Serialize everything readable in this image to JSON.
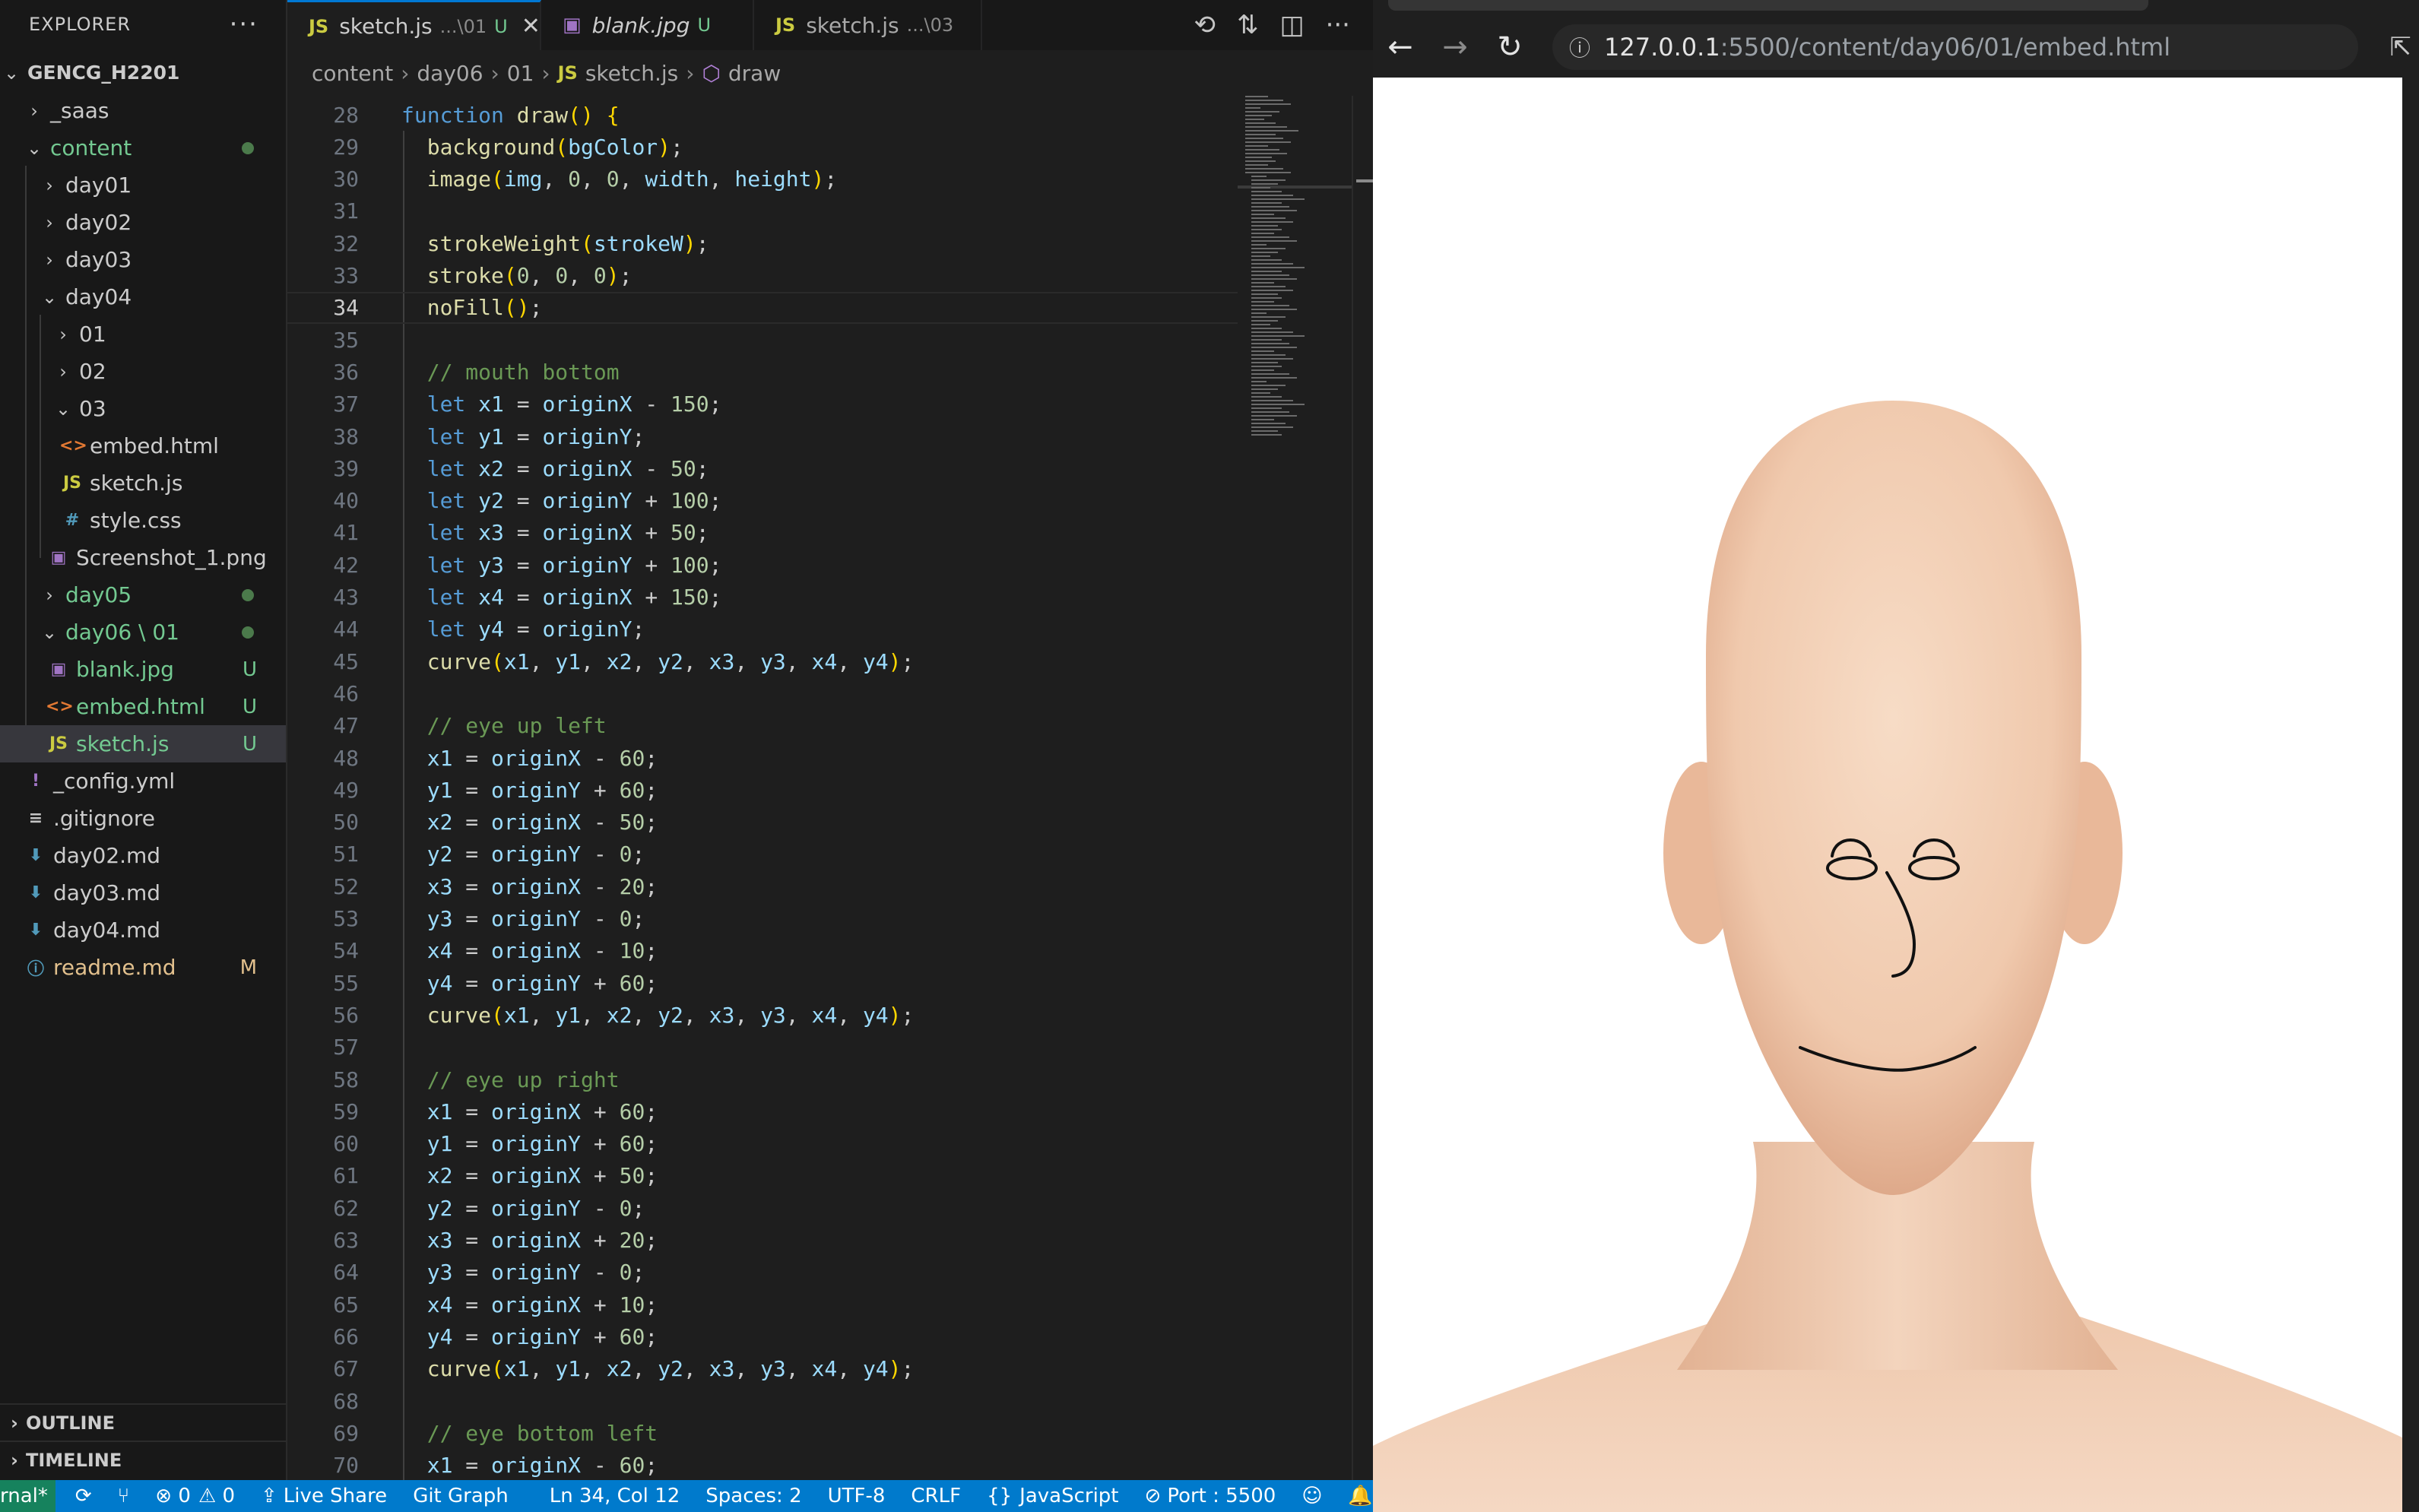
{
  "explorer": {
    "title": "EXPLORER",
    "more": "···",
    "root": "GENCG_H2201",
    "items": [
      {
        "label": "_saas",
        "badge": ""
      },
      {
        "label": "content",
        "badge": ""
      },
      {
        "label": "day01",
        "badge": ""
      },
      {
        "label": "day02",
        "badge": ""
      },
      {
        "label": "day03",
        "badge": ""
      },
      {
        "label": "day04",
        "badge": ""
      },
      {
        "label": "01",
        "badge": ""
      },
      {
        "label": "02",
        "badge": ""
      },
      {
        "label": "03",
        "badge": ""
      },
      {
        "label": "embed.html",
        "badge": ""
      },
      {
        "label": "sketch.js",
        "badge": ""
      },
      {
        "label": "style.css",
        "badge": ""
      },
      {
        "label": "Screenshot_1.png",
        "badge": ""
      },
      {
        "label": "day05",
        "badge": ""
      },
      {
        "label": "day06 \\ 01",
        "badge": ""
      },
      {
        "label": "blank.jpg",
        "badge": "U"
      },
      {
        "label": "embed.html",
        "badge": "U"
      },
      {
        "label": "sketch.js",
        "badge": "U"
      },
      {
        "label": "_config.yml",
        "badge": ""
      },
      {
        "label": ".gitignore",
        "badge": ""
      },
      {
        "label": "day02.md",
        "badge": ""
      },
      {
        "label": "day03.md",
        "badge": ""
      },
      {
        "label": "day04.md",
        "badge": ""
      },
      {
        "label": "readme.md",
        "badge": "M"
      }
    ],
    "outline": "OUTLINE",
    "timeline": "TIMELINE"
  },
  "tabs": [
    {
      "icon": "JS",
      "label": "sketch.js",
      "desc": "...\\01",
      "status": "U",
      "close": "✕"
    },
    {
      "icon": "▣",
      "label": "blank.jpg",
      "desc": "",
      "status": "U",
      "close": ""
    },
    {
      "icon": "JS",
      "label": "sketch.js",
      "desc": "...\\03",
      "status": "",
      "close": ""
    }
  ],
  "breadcrumb": [
    "content",
    "day06",
    "01",
    "sketch.js",
    "draw"
  ],
  "code": {
    "current_line": 34,
    "lines": [
      {
        "n": "28"
      },
      {
        "n": "29"
      },
      {
        "n": "30"
      },
      {
        "n": "31"
      },
      {
        "n": "32"
      },
      {
        "n": "33"
      },
      {
        "n": "34"
      },
      {
        "n": "35"
      },
      {
        "n": "36"
      },
      {
        "n": "37"
      },
      {
        "n": "38"
      },
      {
        "n": "39"
      },
      {
        "n": "40"
      },
      {
        "n": "41"
      },
      {
        "n": "42"
      },
      {
        "n": "43"
      },
      {
        "n": "44"
      },
      {
        "n": "45"
      },
      {
        "n": "46"
      },
      {
        "n": "47"
      },
      {
        "n": "48"
      },
      {
        "n": "49"
      },
      {
        "n": "50"
      },
      {
        "n": "51"
      },
      {
        "n": "52"
      },
      {
        "n": "53"
      },
      {
        "n": "54"
      },
      {
        "n": "55"
      },
      {
        "n": "56"
      },
      {
        "n": "57"
      },
      {
        "n": "58"
      },
      {
        "n": "59"
      },
      {
        "n": "60"
      },
      {
        "n": "61"
      },
      {
        "n": "62"
      },
      {
        "n": "63"
      },
      {
        "n": "64"
      },
      {
        "n": "65"
      },
      {
        "n": "66"
      },
      {
        "n": "67"
      },
      {
        "n": "68"
      },
      {
        "n": "69"
      },
      {
        "n": "70"
      }
    ],
    "text": [
      "function draw() {",
      "  background(bgColor);",
      "  image(img, 0, 0, width, height);",
      "",
      "  strokeWeight(strokeW);",
      "  stroke(0, 0, 0);",
      "  noFill();",
      "",
      "  // mouth bottom",
      "  let x1 = originX - 150;",
      "  let y1 = originY;",
      "  let x2 = originX - 50;",
      "  let y2 = originY + 100;",
      "  let x3 = originX + 50;",
      "  let y3 = originY + 100;",
      "  let x4 = originX + 150;",
      "  let y4 = originY;",
      "  curve(x1, y1, x2, y2, x3, y3, x4, y4);",
      "",
      "  // eye up left",
      "  x1 = originX - 60;",
      "  y1 = originY + 60;",
      "  x2 = originX - 50;",
      "  y2 = originY - 0;",
      "  x3 = originX - 20;",
      "  y3 = originY - 0;",
      "  x4 = originX - 10;",
      "  y4 = originY + 60;",
      "  curve(x1, y1, x2, y2, x3, y3, x4, y4);",
      "",
      "  // eye up right",
      "  x1 = originX + 60;",
      "  y1 = originY + 60;",
      "  x2 = originX + 50;",
      "  y2 = originY - 0;",
      "  x3 = originX + 20;",
      "  y3 = originY - 0;",
      "  x4 = originX + 10;",
      "  y4 = originY + 60;",
      "  curve(x1, y1, x2, y2, x3, y3, x4, y4);",
      "",
      "  // eye bottom left",
      "  x1 = originX - 60;"
    ]
  },
  "statusbar": {
    "remote": "rnal*",
    "sync": "⟳",
    "errors": "⊗ 0",
    "warnings": "⚠ 0",
    "live_share": "Live Share",
    "git_graph": "Git Graph",
    "position": "Ln 34, Col 12",
    "spaces": "Spaces: 2",
    "encoding": "UTF-8",
    "eol": "CRLF",
    "language": "JavaScript",
    "port": "Port : 5500",
    "bell": "🔔"
  },
  "browser": {
    "url_host": "127.0.0.1",
    "url_path": ":5500/content/day06/01/embed.html",
    "back": "←",
    "forward": "→",
    "reload": "↻"
  },
  "colors": {
    "accent": "#007acc",
    "skin": "#f2cfb3",
    "untracked": "#73c991",
    "modified": "#e2c08d"
  }
}
